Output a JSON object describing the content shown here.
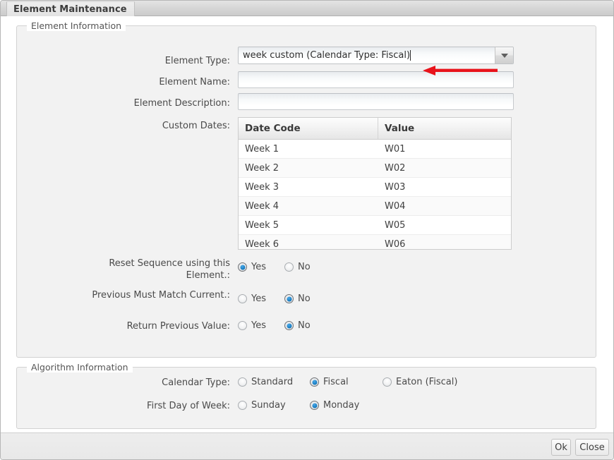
{
  "window": {
    "title": "Element Maintenance"
  },
  "element_information": {
    "legend": "Element Information",
    "fields": {
      "element_type_label": "Element Type:",
      "element_type_value": "week custom (Calendar Type: Fiscal)",
      "element_name_label": "Element Name:",
      "element_name_value": "",
      "element_description_label": "Element Description:",
      "element_description_value": "",
      "custom_dates_label": "Custom Dates:"
    },
    "custom_dates_table": {
      "columns": [
        "Date Code",
        "Value"
      ],
      "rows": [
        [
          "Week 1",
          "W01"
        ],
        [
          "Week 2",
          "W02"
        ],
        [
          "Week 3",
          "W03"
        ],
        [
          "Week 4",
          "W04"
        ],
        [
          "Week 5",
          "W05"
        ],
        [
          "Week 6",
          "W06"
        ]
      ]
    },
    "options": [
      {
        "label": "Reset Sequence using this Element.:",
        "choices": [
          "Yes",
          "No"
        ],
        "selected": "Yes"
      },
      {
        "label": "Previous Must Match Current.:",
        "choices": [
          "Yes",
          "No"
        ],
        "selected": "No"
      },
      {
        "label": "Return Previous Value:",
        "choices": [
          "Yes",
          "No"
        ],
        "selected": "No"
      }
    ]
  },
  "algorithm_information": {
    "legend": "Algorithm Information",
    "calendar_type": {
      "label": "Calendar Type:",
      "choices": [
        "Standard",
        "Fiscal",
        "Eaton (Fiscal)"
      ],
      "selected": "Fiscal"
    },
    "first_day_of_week": {
      "label": "First Day of Week:",
      "choices": [
        "Sunday",
        "Monday"
      ],
      "selected": "Monday"
    }
  },
  "annotation": {
    "type": "red-left-arrow",
    "color": "#e8131b",
    "points_at": "element_type_value"
  },
  "footer": {
    "ok_label": "Ok",
    "close_label": "Close"
  },
  "icons": {
    "dropdown": "chevron-down-icon"
  }
}
